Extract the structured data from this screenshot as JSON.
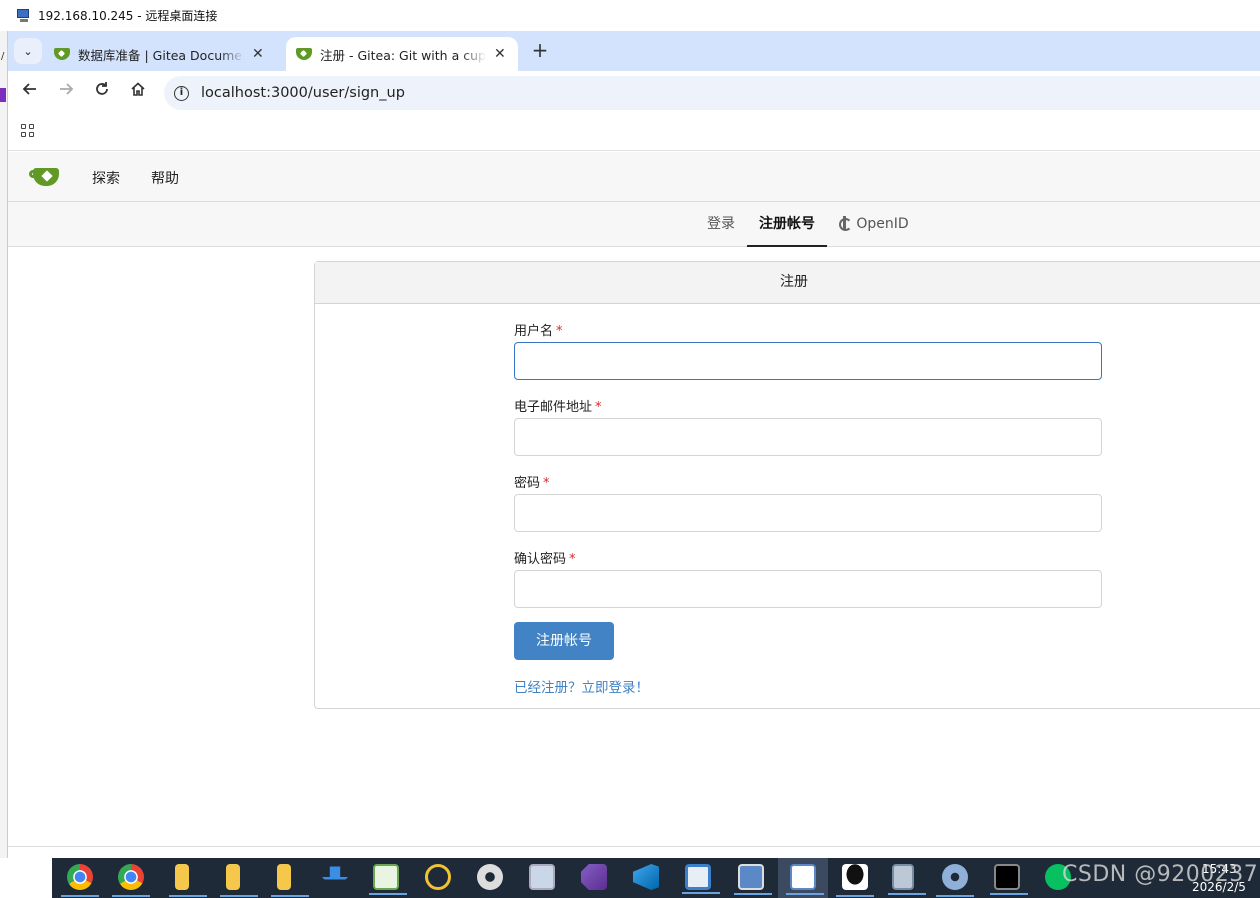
{
  "remote_desktop": {
    "title": "192.168.10.245 - 远程桌面连接"
  },
  "left_strip": {
    "mark": "/"
  },
  "browser": {
    "tabs": [
      {
        "label": "数据库准备 | Gitea Documentation",
        "close": "✕"
      },
      {
        "label": "注册 - Gitea: Git with a cup of tea",
        "close": "✕"
      }
    ],
    "new_tab": "+",
    "tab_dropdown": "⌄",
    "url": "localhost:3000/user/sign_up"
  },
  "gitea": {
    "nav": {
      "explore": "探索",
      "help": "帮助"
    },
    "subtabs": {
      "login": "登录",
      "register": "注册帐号",
      "openid": "OpenID"
    },
    "form": {
      "header": "注册",
      "username_label": "用户名",
      "email_label": "电子邮件地址",
      "password_label": "密码",
      "confirm_label": "确认密码",
      "required": "*",
      "submit": "注册帐号",
      "signin_link": "已经注册？立即登录！"
    }
  },
  "taskbar": {
    "time": "15:43",
    "date": "2026/2/5"
  },
  "watermark": "CSDN @9200237",
  "colors": {
    "accent": "#4183c4",
    "gitea_green": "#609926",
    "required": "#db2828",
    "tab_strip": "#d3e3fd"
  }
}
